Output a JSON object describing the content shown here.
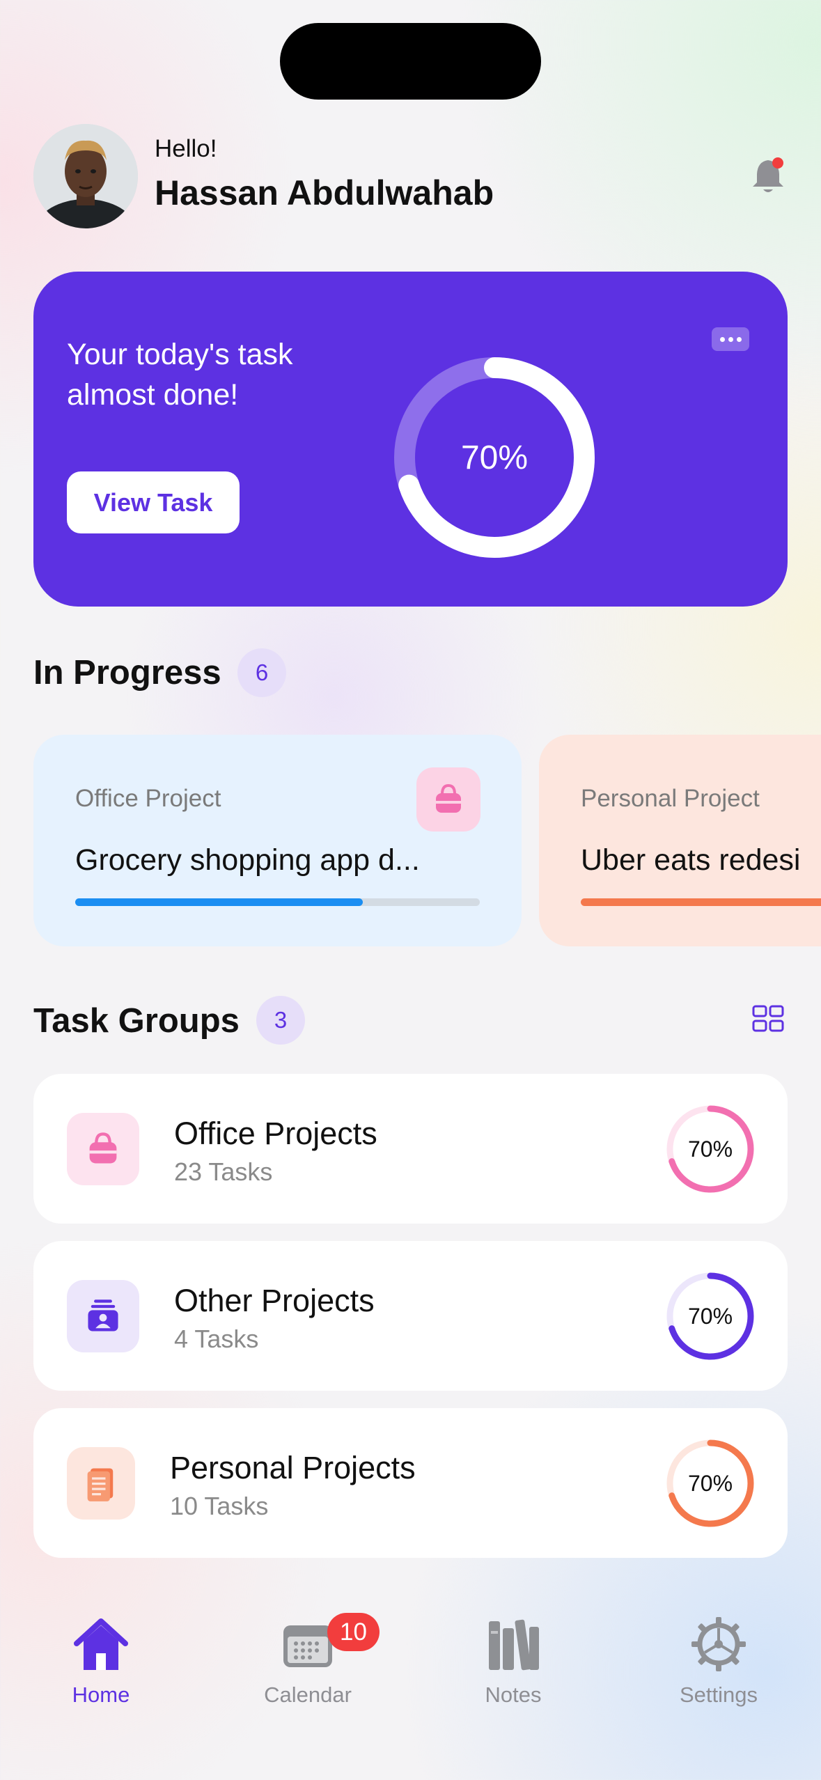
{
  "header": {
    "greeting": "Hello!",
    "user_name": "Hassan Abdulwahab",
    "notification_dot": true
  },
  "hero": {
    "message": "Your today's task almost done!",
    "button_label": "View Task",
    "progress_label": "70%",
    "progress_value": 0.7,
    "background": "#5d31e2"
  },
  "in_progress": {
    "title": "In Progress",
    "count": "6",
    "cards": [
      {
        "category": "Office Project",
        "title": "Grocery shopping app d...",
        "progress": 0.71,
        "bar_color": "#1b8ef2",
        "icon": "shopping-bag-icon"
      },
      {
        "category": "Personal Project",
        "title": "Uber eats redesi",
        "progress": 1.0,
        "bar_color": "#f4794d"
      }
    ]
  },
  "task_groups": {
    "title": "Task Groups",
    "count": "3",
    "groups": [
      {
        "name": "Office Projects",
        "tasks": "23 Tasks",
        "percent": "70%",
        "value": 0.7,
        "color": "#f26fb0",
        "track": "#fde3ef",
        "icon": "shopping-bag-icon",
        "icon_bg": "#fde3ef"
      },
      {
        "name": "Other Projects",
        "tasks": "4 Tasks",
        "percent": "70%",
        "value": 0.7,
        "color": "#5d31e2",
        "track": "#ece6fb",
        "icon": "id-card-icon",
        "icon_bg": "#ece6fb"
      },
      {
        "name": "Personal Projects",
        "tasks": "10 Tasks",
        "percent": "70%",
        "value": 0.7,
        "color": "#f4794d",
        "track": "#fde6de",
        "icon": "notebook-icon",
        "icon_bg": "#fde6de"
      }
    ]
  },
  "nav": {
    "items": [
      {
        "label": "Home",
        "icon": "home-icon",
        "active": true
      },
      {
        "label": "Calendar",
        "icon": "calendar-icon",
        "badge": "10"
      },
      {
        "label": "Notes",
        "icon": "books-icon"
      },
      {
        "label": "Settings",
        "icon": "gear-icon"
      }
    ]
  }
}
